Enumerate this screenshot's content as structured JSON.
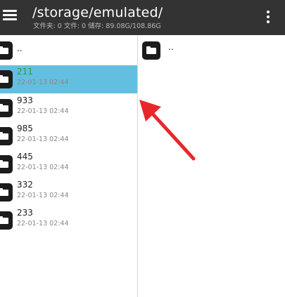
{
  "header": {
    "path": "/storage/emulated/",
    "stats": "文件夹: 0   文件: 0   储存: 89.08G/108.86G"
  },
  "left_pane": {
    "parent_label": "..",
    "items": [
      {
        "name": "211",
        "date": "22-01-13 02:44",
        "selected": true
      },
      {
        "name": "933",
        "date": "22-01-13 02:44",
        "selected": false
      },
      {
        "name": "985",
        "date": "22-01-13 02:44",
        "selected": false
      },
      {
        "name": "445",
        "date": "22-01-13 02:44",
        "selected": false
      },
      {
        "name": "332",
        "date": "22-01-13 02:44",
        "selected": false
      },
      {
        "name": "233",
        "date": "22-01-13 02:44",
        "selected": false
      }
    ]
  },
  "right_pane": {
    "parent_label": ".."
  },
  "icons": {
    "menu": "hamburger-menu-icon",
    "more": "more-vert-icon",
    "folder": "folder-icon",
    "annotation": "red-arrow-icon"
  },
  "colors": {
    "toolbar": "#333333",
    "selected_row": "#63bfe0",
    "selected_text": "#2e9c3a",
    "arrow": "#e8272b"
  }
}
